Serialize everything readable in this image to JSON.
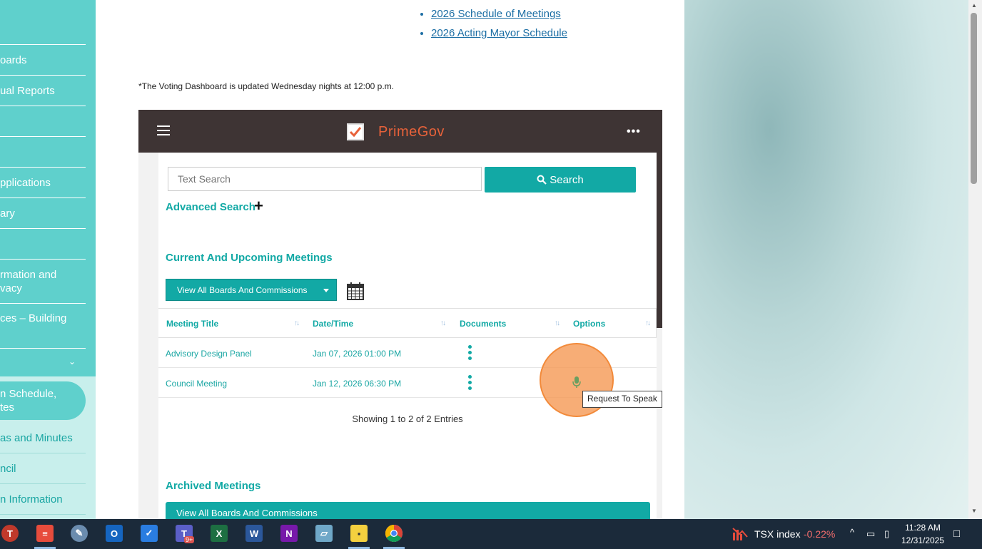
{
  "nav": {
    "items": [
      {
        "label": "oards"
      },
      {
        "label": "ual Reports"
      },
      {
        "label": "pplications"
      },
      {
        "label": "ary"
      },
      {
        "label": "rmation and"
      },
      {
        "label": "vacy"
      },
      {
        "label": "ces – Building"
      }
    ],
    "active_line1": "n Schedule,",
    "active_line2": "tes",
    "sub_items": [
      {
        "label": "as and Minutes"
      },
      {
        "label": "ncil"
      },
      {
        "label": "n Information"
      }
    ]
  },
  "links": [
    "2026 Schedule of Meetings",
    "2026 Acting Mayor Schedule"
  ],
  "note": "*The Voting Dashboard is updated Wednesday nights at 12:00 p.m.",
  "primegov": {
    "brand": "PrimeGov",
    "search_placeholder": "Text Search",
    "search_button": "Search",
    "advanced_search": "Advanced Search",
    "current_title": "Current And Upcoming Meetings",
    "filter_label": "View All Boards And Commissions",
    "columns": [
      "Meeting Title",
      "Date/Time",
      "Documents",
      "Options"
    ],
    "rows": [
      {
        "title": "Advisory Design Panel",
        "datetime": "Jan 07, 2026 01:00 PM"
      },
      {
        "title": "Council Meeting",
        "datetime": "Jan 12, 2026 06:30 PM"
      }
    ],
    "showing": "Showing 1 to 2 of 2 Entries",
    "archived_title": "Archived Meetings",
    "archived_filter": "View All Boards And Commissions"
  },
  "tooltip": "Request To Speak",
  "taskbar": {
    "tsx_label": "TSX index",
    "tsx_value": "-0.22%",
    "time": "11:28 AM",
    "date": "12/31/2025",
    "teams_badge": "9+"
  },
  "colors": {
    "teal": "#12a9a5",
    "nav_teal": "#5fd0cc",
    "brand_orange": "#e8623a",
    "header_dark": "#3e3434"
  }
}
